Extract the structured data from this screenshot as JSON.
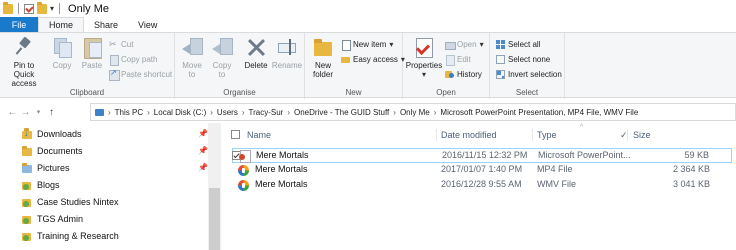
{
  "window": {
    "title": "Only Me",
    "quick_access_dropdown": "▾"
  },
  "tabs": [
    {
      "label": "File"
    },
    {
      "label": "Home"
    },
    {
      "label": "Share"
    },
    {
      "label": "View"
    }
  ],
  "ribbon": {
    "clipboard": {
      "group_label": "Clipboard",
      "pin_label": "Pin to Quick access",
      "copy_label": "Copy",
      "paste_label": "Paste",
      "cut_label": "Cut",
      "copy_path_label": "Copy path",
      "paste_shortcut_label": "Paste shortcut"
    },
    "organise": {
      "group_label": "Organise",
      "move_label": "Move to",
      "copy_to_label": "Copy to",
      "delete_label": "Delete",
      "rename_label": "Rename"
    },
    "new": {
      "group_label": "New",
      "new_folder_label": "New folder",
      "new_item_label": "New item",
      "easy_access_label": "Easy access"
    },
    "open": {
      "group_label": "Open",
      "properties_label": "Properties",
      "open_label": "Open",
      "edit_label": "Edit",
      "history_label": "History"
    },
    "select": {
      "group_label": "Select",
      "select_all_label": "Select all",
      "select_none_label": "Select none",
      "invert_label": "Invert selection"
    }
  },
  "address": {
    "crumbs": [
      "This PC",
      "Local Disk (C:)",
      "Users",
      "Tracy-Sur",
      "OneDrive - The GUID Stuff",
      "Only Me",
      "Microsoft PowerPoint Presentation, MP4 File, WMV File"
    ]
  },
  "navigation": {
    "items": [
      {
        "label": "Downloads",
        "pinned": true,
        "icon": "download-folder-icon"
      },
      {
        "label": "Documents",
        "pinned": true,
        "icon": "documents-folder-icon"
      },
      {
        "label": "Pictures",
        "pinned": true,
        "icon": "pictures-folder-icon"
      },
      {
        "label": "Blogs",
        "pinned": false,
        "icon": "shared-folder-icon"
      },
      {
        "label": "Case Studies Nintex",
        "pinned": false,
        "icon": "shared-folder-icon"
      },
      {
        "label": "TGS Admin",
        "pinned": false,
        "icon": "shared-folder-icon"
      },
      {
        "label": "Training & Research",
        "pinned": false,
        "icon": "shared-folder-icon"
      }
    ]
  },
  "filelist": {
    "columns": {
      "name": "Name",
      "date": "Date modified",
      "type": "Type",
      "size": "Size"
    },
    "rows": [
      {
        "name": "Mere Mortals",
        "date": "2016/11/15 12:32 PM",
        "type": "Microsoft PowerPoint...",
        "size": "59 KB",
        "icon": "powerpoint-icon",
        "selected": true
      },
      {
        "name": "Mere Mortals",
        "date": "2017/01/07 1:40 PM",
        "type": "MP4 File",
        "size": "2 364 KB",
        "icon": "media-player-icon",
        "selected": false
      },
      {
        "name": "Mere Mortals",
        "date": "2016/12/28 9:55 AM",
        "type": "WMV File",
        "size": "3 041 KB",
        "icon": "media-player-icon",
        "selected": false
      }
    ]
  }
}
